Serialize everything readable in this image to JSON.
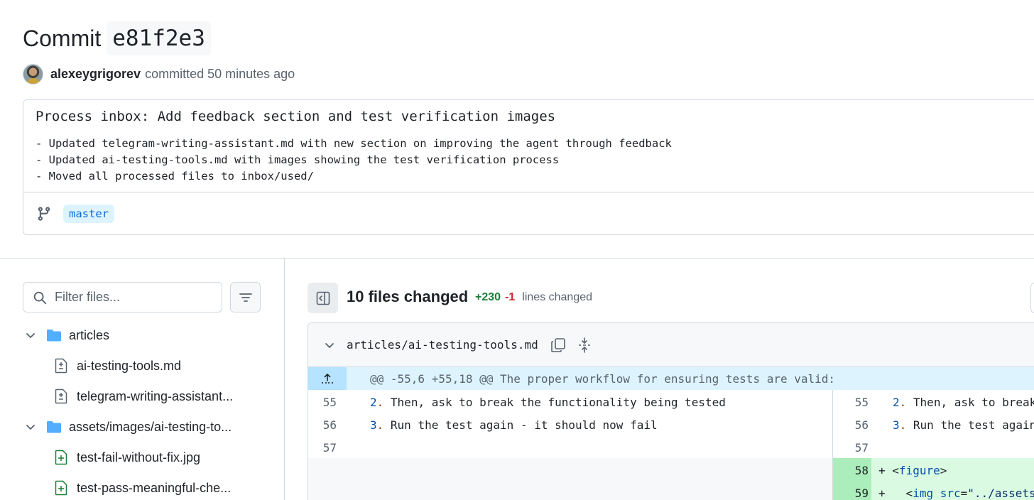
{
  "commit": {
    "title_word": "Commit",
    "sha": "e81f2e3",
    "author": "alexeygrigorev",
    "committed_text": "committed 50 minutes ago",
    "message_title": "Process inbox: Add feedback section and test verification images",
    "message_body": "- Updated telegram-writing-assistant.md with new section on improving the agent through feedback\n- Updated ai-testing-tools.md with images showing the test verification process\n- Moved all processed files to inbox/used/",
    "branch": "master"
  },
  "sidebar": {
    "filter_placeholder": "Filter files...",
    "tree": [
      {
        "type": "folder",
        "label": "articles"
      },
      {
        "type": "file-modified",
        "label": "ai-testing-tools.md"
      },
      {
        "type": "file-modified",
        "label": "telegram-writing-assistant..."
      },
      {
        "type": "folder",
        "label": "assets/images/ai-testing-to..."
      },
      {
        "type": "file-added",
        "label": "test-fail-without-fix.jpg"
      },
      {
        "type": "file-added",
        "label": "test-pass-meaningful-che..."
      }
    ]
  },
  "summary": {
    "files_changed": "10 files changed",
    "additions": "+230",
    "deletions": "-1",
    "lines_changed": "lines changed"
  },
  "diff": {
    "file_path": "articles/ai-testing-tools.md",
    "hunk_header": "@@ -55,6 +55,18 @@ The proper workflow for ensuring tests are valid:",
    "left_lines": [
      {
        "num": "55",
        "marker": "2",
        "text": " Then, ask to break the functionality being tested"
      },
      {
        "num": "56",
        "marker": "3",
        "text": " Run the test again - it should now fail"
      },
      {
        "num": "57",
        "marker": "",
        "text": ""
      }
    ],
    "right_lines": [
      {
        "num": "55",
        "marker": "2",
        "text": " Then, ask to break"
      },
      {
        "num": "56",
        "marker": "3",
        "text": " Run the test again"
      },
      {
        "num": "57",
        "marker": "",
        "text": ""
      }
    ],
    "added_lines": [
      {
        "num": "58",
        "sign": "+",
        "tag_open": "<",
        "tag": "figure",
        "tag_close": ">"
      },
      {
        "num": "59",
        "sign": "+",
        "tag_open": "  <",
        "tag": "img",
        "attr": " src",
        "eq": "=",
        "str": "\"../assets"
      }
    ]
  },
  "colors": {
    "accent": "#0969da",
    "add_text": "#1a7f37",
    "del_text": "#d1242f",
    "add_bg": "#dafbe1",
    "add_gutter": "#aceebb",
    "hunk_bg": "#ddf4ff"
  },
  "icons": [
    "branch-icon",
    "search-icon",
    "filter-icon",
    "chevron-down-icon",
    "folder-icon",
    "file-diff-icon",
    "file-added-icon",
    "sidebar-toggle-icon",
    "copy-icon",
    "expand-icon"
  ]
}
